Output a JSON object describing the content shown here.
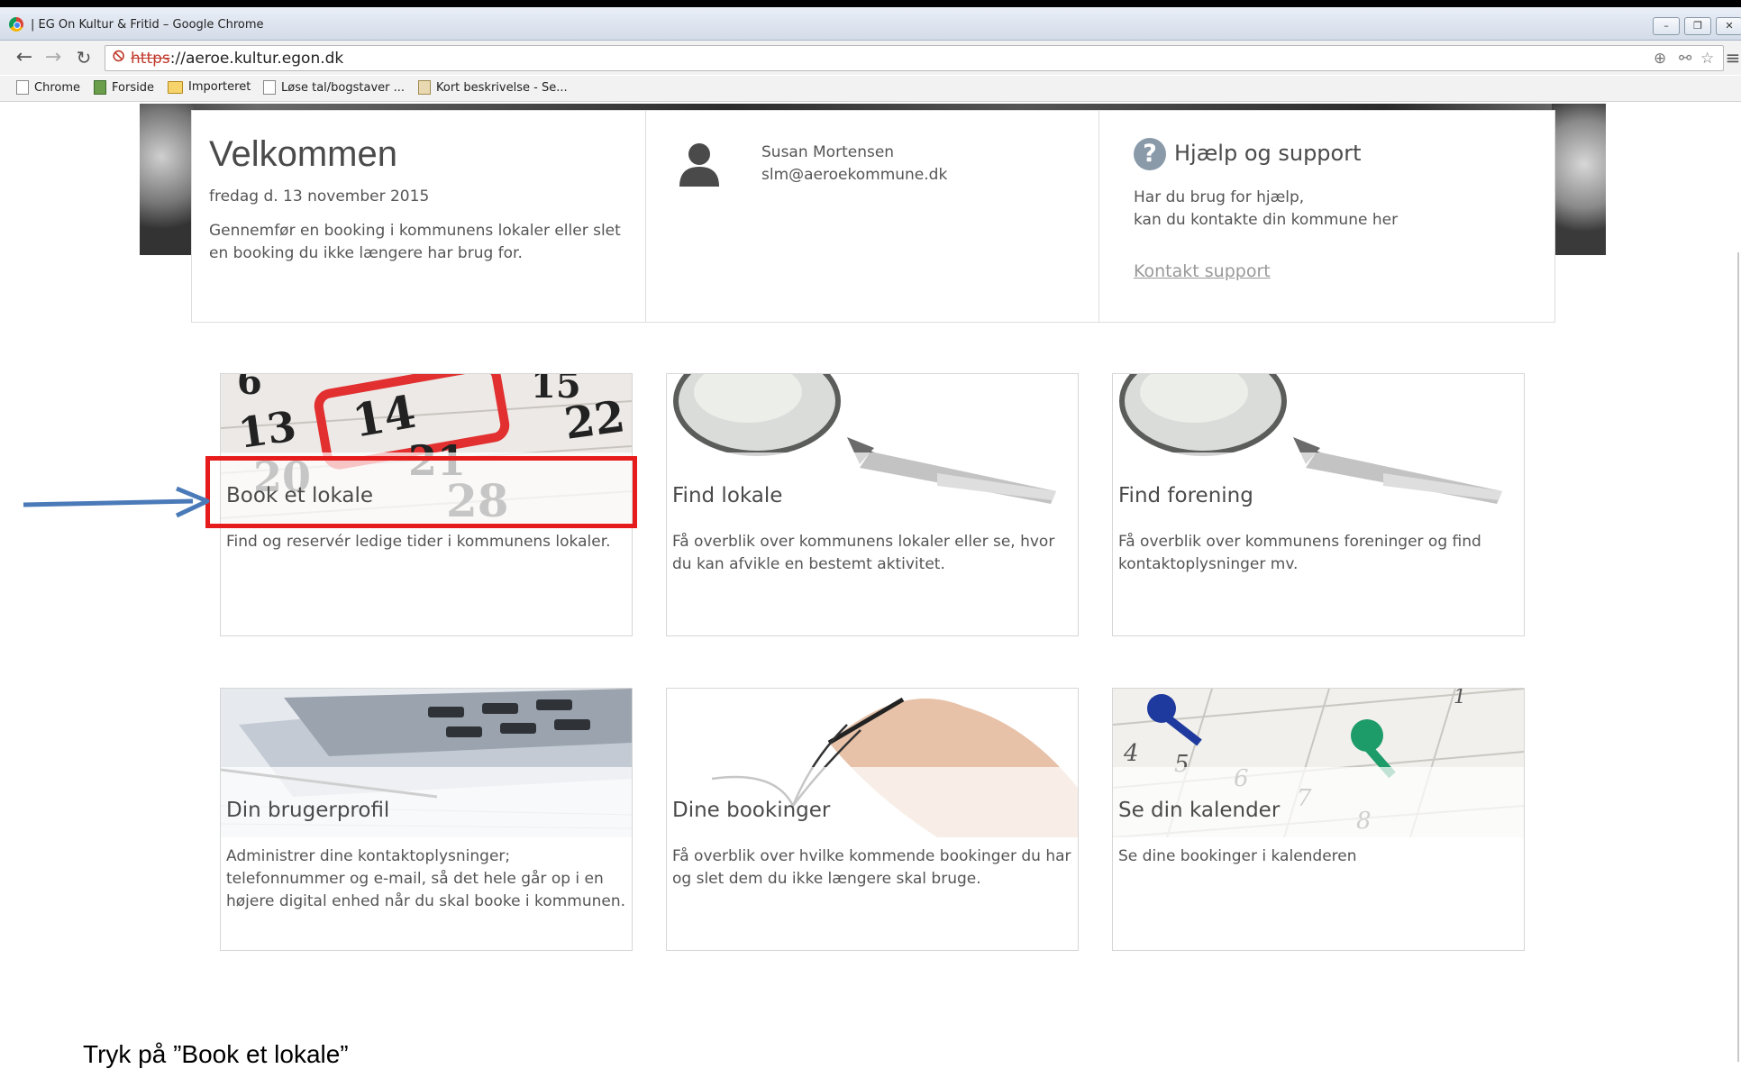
{
  "browser": {
    "window_title": "| EG On Kultur & Fritid – Google Chrome",
    "url_scheme": "https",
    "url_rest": "://aeroe.kultur.egon.dk",
    "bookmarks": [
      {
        "label": "Chrome",
        "icon": "page-icon"
      },
      {
        "label": "Forside",
        "icon": "site-icon"
      },
      {
        "label": "Importeret",
        "icon": "folder-icon"
      },
      {
        "label": "Løse tal/bogstaver ...",
        "icon": "page-icon"
      },
      {
        "label": "Kort beskrivelse - Se...",
        "icon": "site-icon"
      }
    ]
  },
  "welcome": {
    "title": "Velkommen",
    "date": "fredag d. 13 november 2015",
    "description": "Gennemfør en booking i kommunens lokaler eller slet en booking du ikke længere har brug for."
  },
  "user": {
    "name": "Susan Mortensen",
    "email": "slm@aeroekommune.dk"
  },
  "help": {
    "title": "Hjælp og support",
    "line1": "Har du brug for hjælp,",
    "line2": "kan du kontakte din kommune her",
    "link": "Kontakt support"
  },
  "tiles": [
    {
      "title": "Book et lokale",
      "description": "Find og reservér ledige tider i kommunens lokaler.",
      "image": "calendar-image"
    },
    {
      "title": "Find lokale",
      "description": "Få overblik over kommunens lokaler eller se, hvor du kan afvikle en bestemt aktivitet.",
      "image": "magnifier-image"
    },
    {
      "title": "Find forening",
      "description": "Få overblik over kommunens foreninger og find kontaktoplysninger mv.",
      "image": "magnifier-image"
    },
    {
      "title": "Din brugerprofil",
      "description": "Administrer dine kontaktoplysninger; telefonnummer og e-mail, så det hele går op i en højere digital enhed når du skal booke i kommunen.",
      "image": "calculator-image"
    },
    {
      "title": "Dine bookinger",
      "description": "Få overblik over hvilke kommende bookinger du har og slet dem du ikke længere skal bruge.",
      "image": "hand-pen-image"
    },
    {
      "title": "Se din kalender",
      "description": "Se dine bookinger i kalenderen",
      "image": "pinned-calendar-image"
    }
  ],
  "annotation": {
    "instruction": "Tryk på ”Book et lokale”",
    "highlight_color": "#e61b1b",
    "arrow_color": "#4a7ab8"
  }
}
